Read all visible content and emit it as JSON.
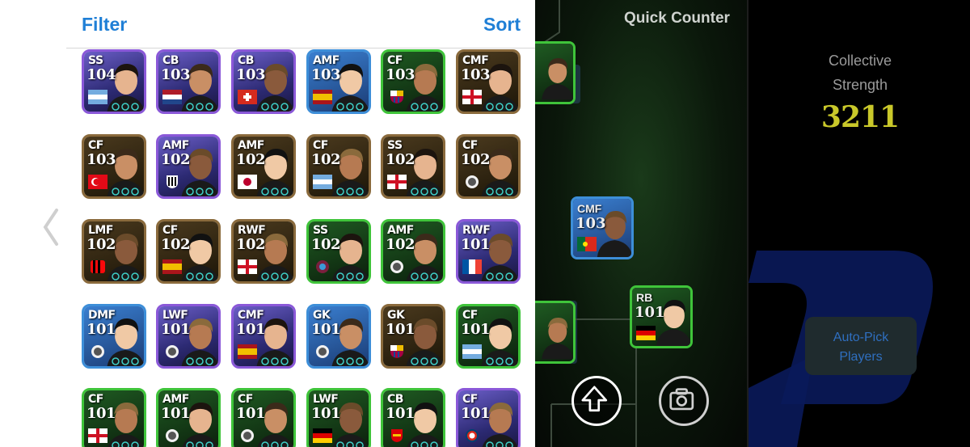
{
  "panel": {
    "filter_label": "Filter",
    "sort_label": "Sort",
    "cards": [
      {
        "pos": "SS",
        "ovr": "104",
        "border": "purple",
        "flag": "argentina"
      },
      {
        "pos": "CB",
        "ovr": "103",
        "border": "purple",
        "flag": "netherlands"
      },
      {
        "pos": "CB",
        "ovr": "103",
        "border": "purple",
        "flag": "switzerland"
      },
      {
        "pos": "AMF",
        "ovr": "103",
        "border": "blue",
        "flag": "spain"
      },
      {
        "pos": "CF",
        "ovr": "103",
        "border": "green",
        "flag": "barcelona-crest"
      },
      {
        "pos": "CMF",
        "ovr": "103",
        "border": "gold",
        "flag": "england"
      },
      {
        "pos": "CF",
        "ovr": "103",
        "border": "gold",
        "flag": "turkey"
      },
      {
        "pos": "AMF",
        "ovr": "102",
        "border": "purple",
        "flag": "santos-crest"
      },
      {
        "pos": "AMF",
        "ovr": "102",
        "border": "gold",
        "flag": "japan"
      },
      {
        "pos": "CF",
        "ovr": "102",
        "border": "gold",
        "flag": "argentina"
      },
      {
        "pos": "SS",
        "ovr": "102",
        "border": "gold",
        "flag": "england"
      },
      {
        "pos": "CF",
        "ovr": "102",
        "border": "gold",
        "flag": "club-crest"
      },
      {
        "pos": "LMF",
        "ovr": "102",
        "border": "gold",
        "flag": "milan-crest"
      },
      {
        "pos": "CF",
        "ovr": "102",
        "border": "gold",
        "flag": "spain"
      },
      {
        "pos": "RWF",
        "ovr": "102",
        "border": "gold",
        "flag": "england"
      },
      {
        "pos": "SS",
        "ovr": "102",
        "border": "green",
        "flag": "trabzon-crest"
      },
      {
        "pos": "AMF",
        "ovr": "102",
        "border": "green",
        "flag": "club-crest"
      },
      {
        "pos": "RWF",
        "ovr": "101",
        "border": "purple",
        "flag": "france"
      },
      {
        "pos": "DMF",
        "ovr": "101",
        "border": "blue",
        "flag": "club-crest"
      },
      {
        "pos": "LWF",
        "ovr": "101",
        "border": "purple",
        "flag": "club-crest"
      },
      {
        "pos": "CMF",
        "ovr": "101",
        "border": "purple",
        "flag": "spain"
      },
      {
        "pos": "GK",
        "ovr": "101",
        "border": "blue",
        "flag": "club-crest"
      },
      {
        "pos": "GK",
        "ovr": "101",
        "border": "gold",
        "flag": "barcelona-crest"
      },
      {
        "pos": "CF",
        "ovr": "101",
        "border": "green",
        "flag": "argentina"
      },
      {
        "pos": "CF",
        "ovr": "101",
        "border": "green",
        "flag": "england"
      },
      {
        "pos": "AMF",
        "ovr": "101",
        "border": "green",
        "flag": "club-crest"
      },
      {
        "pos": "CF",
        "ovr": "101",
        "border": "green",
        "flag": "club-crest"
      },
      {
        "pos": "LWF",
        "ovr": "101",
        "border": "green",
        "flag": "germany"
      },
      {
        "pos": "CB",
        "ovr": "101",
        "border": "green",
        "flag": "arsenal-crest"
      },
      {
        "pos": "CF",
        "ovr": "101",
        "border": "purple",
        "flag": "psg-crest"
      }
    ]
  },
  "pitch": {
    "title": "Quick Counter",
    "cards": [
      {
        "pos": "CMF",
        "ovr": "103",
        "border": "blue"
      },
      {
        "pos": "RB",
        "ovr": "101",
        "border": "green"
      }
    ]
  },
  "summary": {
    "strength_label_1": "Collective",
    "strength_label_2": "Strength",
    "strength_value": "3211",
    "auto_pick_line1": "Auto-Pick",
    "auto_pick_line2": "Players"
  },
  "colors": {
    "accent": "#1f7fd6",
    "strength": "#c9c82a",
    "border_gold": "#8a6a3c",
    "border_green": "#3fc43a",
    "border_purple": "#8a58d8",
    "border_blue": "#3d8ed8"
  }
}
